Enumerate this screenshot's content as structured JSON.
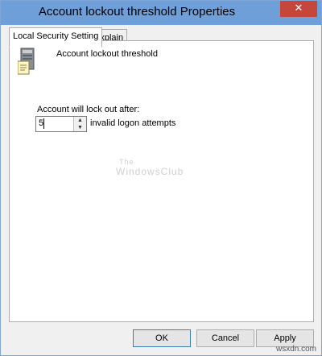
{
  "window": {
    "title": "Account lockout threshold Properties",
    "close_glyph": "✕"
  },
  "tabs": [
    {
      "label": "Local Security Setting",
      "active": true
    },
    {
      "label": "Explain",
      "active": false
    }
  ],
  "policy": {
    "name": "Account lockout threshold",
    "icon": "server-policy-icon"
  },
  "lockout": {
    "label": "Account will lock out after:",
    "value": "5",
    "suffix": "invalid logon attempts",
    "up_glyph": "▲",
    "down_glyph": "▼"
  },
  "watermark": {
    "line1": "The",
    "line2": "WindowsClub"
  },
  "buttons": {
    "ok": "OK",
    "cancel": "Cancel",
    "apply": "Apply"
  },
  "site_mark": "wsxdn.com",
  "colors": {
    "titlebar": "#6f9fd9",
    "close": "#c7463c",
    "window_border": "#7fa6d6"
  }
}
